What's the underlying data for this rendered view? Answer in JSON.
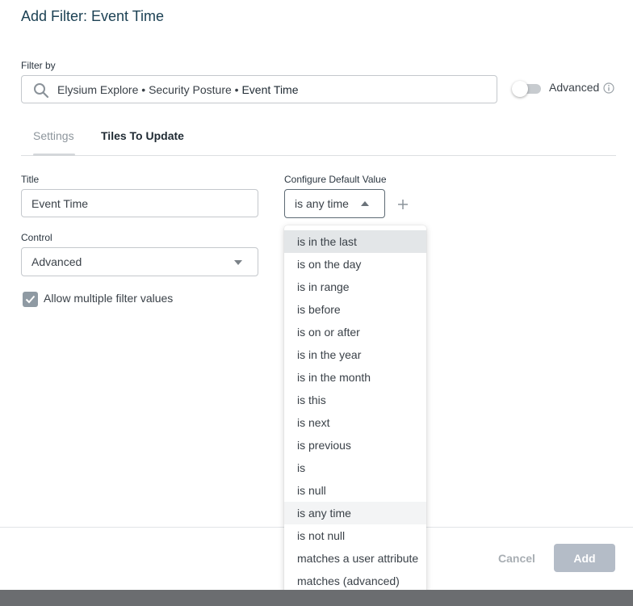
{
  "dialog": {
    "title": "Add Filter: Event Time"
  },
  "filter_by": {
    "label": "Filter by",
    "crumb_1": "Elysium Explore",
    "sep_1": " • ",
    "crumb_2": "Security Posture",
    "sep_2": " • ",
    "crumb_3": "Event Time",
    "advanced_label": "Advanced",
    "advanced_on": false
  },
  "tabs": {
    "settings": "Settings",
    "tiles_to_update": "Tiles To Update",
    "active": "settings"
  },
  "settings": {
    "title_label": "Title",
    "title_value": "Event Time",
    "control_label": "Control",
    "control_value": "Advanced",
    "allow_multiple_label": "Allow multiple filter values",
    "allow_multiple_checked": true,
    "default_value_label": "Configure Default Value",
    "default_value": "is any time"
  },
  "dropdown": {
    "items": [
      "is in the last",
      "is on the day",
      "is in range",
      "is before",
      "is on or after",
      "is in the year",
      "is in the month",
      "is this",
      "is next",
      "is previous",
      "is",
      "is null",
      "is any time",
      "is not null",
      "matches a user attribute",
      "matches (advanced)"
    ],
    "hovered_index": 0,
    "selected_index": 12
  },
  "footer": {
    "cancel_label": "Cancel",
    "add_label": "Add"
  },
  "colors": {
    "title": "#1c4154",
    "add_button": "#b4bcc7",
    "checkbox": "#8f9aa3",
    "hover": "#e3e6e8"
  }
}
